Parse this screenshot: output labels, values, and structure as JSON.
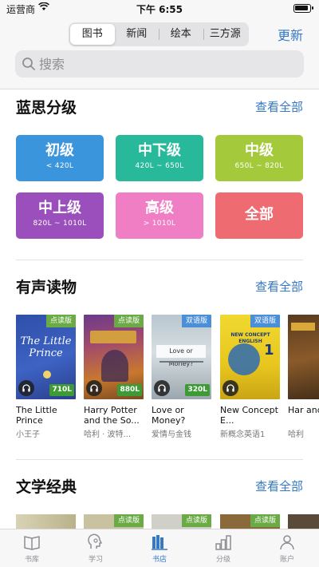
{
  "status_bar": {
    "carrier": "运营商",
    "time": "下午 6:55"
  },
  "header": {
    "tabs": [
      {
        "label": "图书",
        "active": true
      },
      {
        "label": "新闻",
        "active": false
      },
      {
        "label": "绘本",
        "active": false
      },
      {
        "label": "三方源",
        "active": false
      }
    ],
    "update_label": "更新",
    "search_placeholder": "搜索"
  },
  "sections": {
    "levels": {
      "title": "蓝思分级",
      "see_all": "查看全部"
    },
    "audio": {
      "title": "有声读物",
      "see_all": "查看全部"
    },
    "classics": {
      "title": "文学经典",
      "see_all": "查看全部"
    }
  },
  "levels": [
    {
      "name": "初级",
      "range": "< 420L",
      "color": "#3a95dd"
    },
    {
      "name": "中下级",
      "range": "420L ~ 650L",
      "color": "#27b99a"
    },
    {
      "name": "中级",
      "range": "650L ~ 820L",
      "color": "#a4c93a"
    },
    {
      "name": "中上级",
      "range": "820L ~ 1010L",
      "color": "#9a4fbc"
    },
    {
      "name": "高级",
      "range": "> 1010L",
      "color": "#f07ec5"
    },
    {
      "name": "全部",
      "range": "",
      "color": "#ef6b72"
    }
  ],
  "audio_books": [
    {
      "title": "The Little Prince",
      "subtitle": "小王子",
      "tag": "点读版",
      "lexile": "710L",
      "cover_title": "The Little Prince"
    },
    {
      "title": "Harry Potter and the So...",
      "subtitle": "哈利 · 波特...",
      "tag": "点读版",
      "lexile": "880L",
      "cover_title": ""
    },
    {
      "title": "Love or Money?",
      "subtitle": "爱情与金钱",
      "tag": "双语版",
      "lexile": "320L",
      "cover_title": "Love or Money?"
    },
    {
      "title": "New Concept E...",
      "subtitle": "新概念英语1",
      "tag": "双语版",
      "lexile": "",
      "cover_title": "NEW CONCEPT ENGLISH"
    },
    {
      "title": "Har and",
      "subtitle": "哈利",
      "tag": "",
      "lexile": "",
      "cover_title": ""
    }
  ],
  "classics_tags": [
    "点读版",
    "点读版",
    "点读版"
  ],
  "tab_bar": [
    {
      "label": "书库",
      "icon": "library-icon",
      "active": false
    },
    {
      "label": "学习",
      "icon": "study-icon",
      "active": false
    },
    {
      "label": "书店",
      "icon": "store-icon",
      "active": true
    },
    {
      "label": "分级",
      "icon": "grade-icon",
      "active": false
    },
    {
      "label": "账户",
      "icon": "account-icon",
      "active": false
    }
  ],
  "colors": {
    "accent": "#3478c6",
    "lexile_badge": "#3d9a35",
    "tag_green": "#6aab45",
    "tag_blue": "#4a8fd8"
  }
}
